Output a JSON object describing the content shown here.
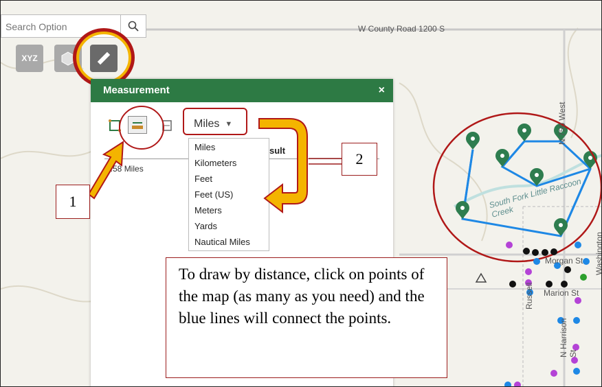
{
  "search": {
    "placeholder": "Search Option"
  },
  "toolbar": {
    "tools": [
      {
        "name": "coordinates-tool",
        "label": "XYZ"
      },
      {
        "name": "area-tool"
      },
      {
        "name": "measure-tool",
        "active": true
      }
    ]
  },
  "panel": {
    "title": "Measurement",
    "close_symbol": "×",
    "unit_selected": "Miles",
    "units": [
      "Miles",
      "Kilometers",
      "Feet",
      "Feet (US)",
      "Meters",
      "Yards",
      "Nautical Miles"
    ],
    "result_label": "sult",
    "result_value": "0.58 Miles"
  },
  "annotations": {
    "callout_1": "1",
    "callout_2": "2",
    "instruction": "To draw by distance, click on points of the map (as many as you need) and the blue lines will connect the points."
  },
  "map_labels": {
    "road": "W County Road 1200 S",
    "street_n750": "N 750 West",
    "creek": "South Fork Little Raccoon Creek",
    "morgan": "Morgan St",
    "marion": "Marion St",
    "harrison": "N Harrison St",
    "washington": "Washington",
    "russell": "Russell"
  },
  "colors": {
    "panel_header": "#2d7a44",
    "highlight_outline": "#b01818",
    "arrow_fill": "#f4b400",
    "measure_line": "#1e88e5",
    "marker": "#2e7d4f"
  }
}
